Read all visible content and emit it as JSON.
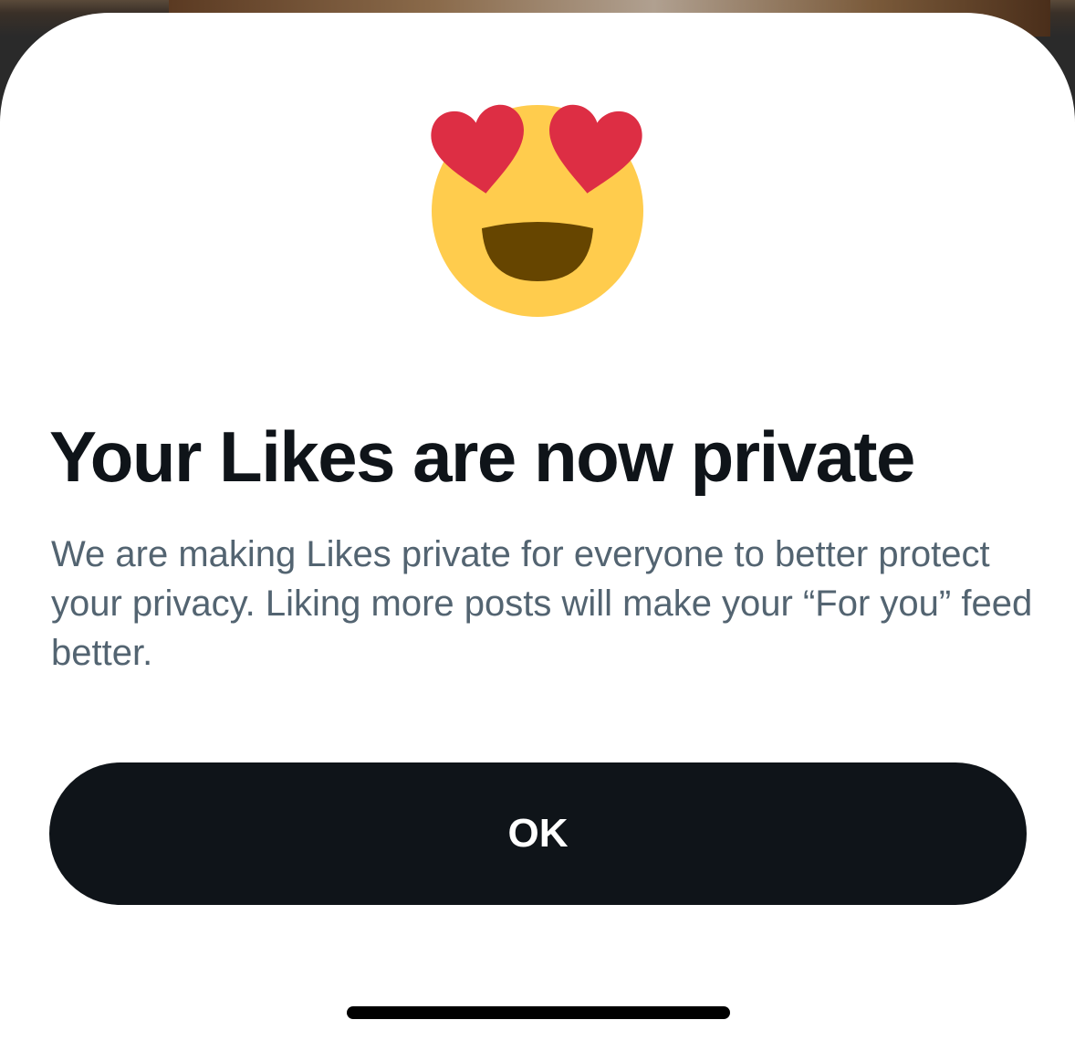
{
  "dialog": {
    "emoji_icon": "smiling-face-with-heart-eyes-icon",
    "title": "Your Likes are now private",
    "body": "We are making Likes private for everyone to better protect your privacy. Liking more posts will make your “For you” feed better.",
    "ok_label": "OK"
  },
  "colors": {
    "button_bg": "#0f1419",
    "title_text": "#0f1419",
    "body_text": "#536471",
    "emoji_face": "#FFCC4D",
    "emoji_hearts": "#DD2E44",
    "emoji_mouth": "#664500"
  }
}
